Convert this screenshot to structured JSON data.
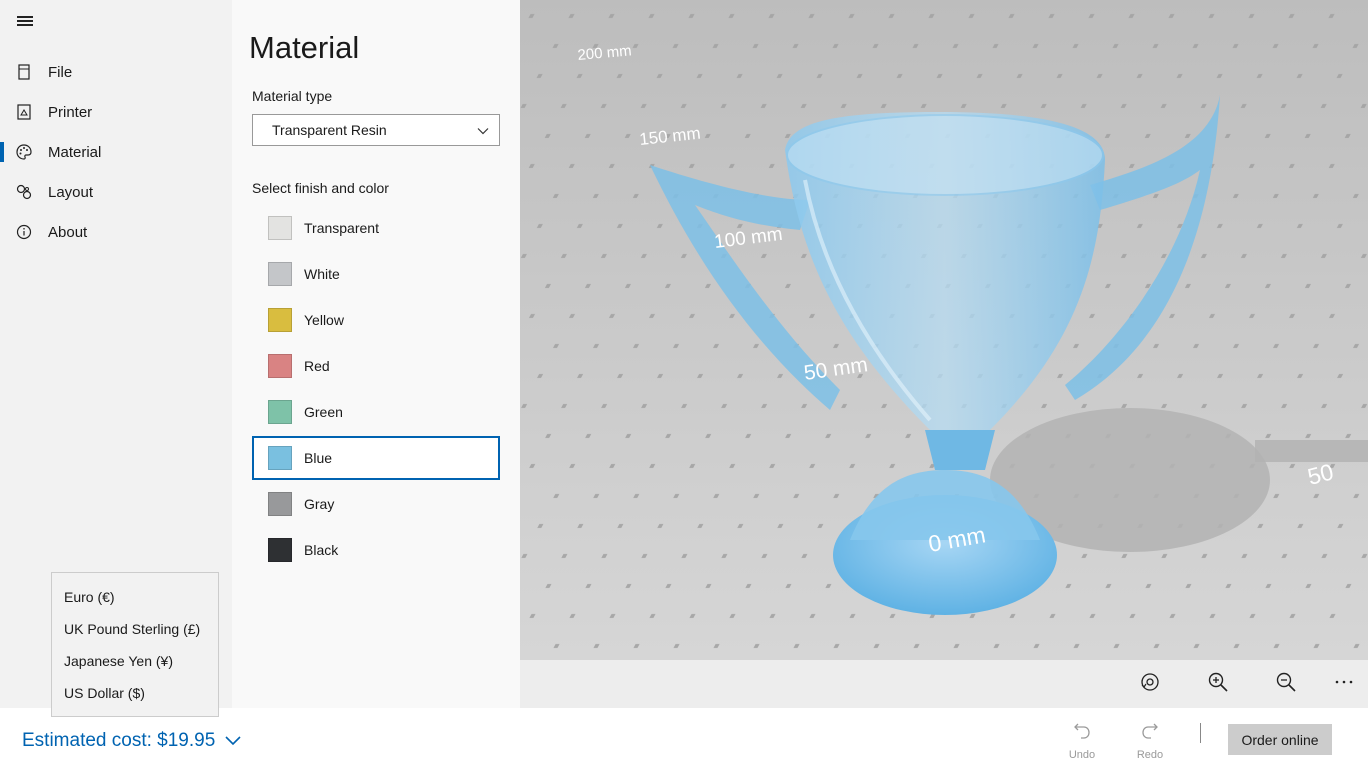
{
  "nav": {
    "items": [
      {
        "label": "File",
        "icon": "file-icon"
      },
      {
        "label": "Printer",
        "icon": "printer-icon"
      },
      {
        "label": "Material",
        "icon": "palette-icon",
        "active": true
      },
      {
        "label": "Layout",
        "icon": "layout-icon"
      },
      {
        "label": "About",
        "icon": "info-icon"
      }
    ]
  },
  "material": {
    "title": "Material",
    "type_label": "Material type",
    "type_value": "Transparent Resin",
    "finish_label": "Select finish and color",
    "colors": [
      {
        "label": "Transparent",
        "color": "#e3e3e1"
      },
      {
        "label": "White",
        "color": "#c4c6c9"
      },
      {
        "label": "Yellow",
        "color": "#d9bd3f"
      },
      {
        "label": "Red",
        "color": "#d98383"
      },
      {
        "label": "Green",
        "color": "#7ec2a8"
      },
      {
        "label": "Blue",
        "color": "#7ac0e0",
        "selected": true
      },
      {
        "label": "Gray",
        "color": "#98999b"
      },
      {
        "label": "Black",
        "color": "#2e3033"
      }
    ]
  },
  "currency": {
    "options": [
      "Euro (€)",
      "UK Pound Sterling (£)",
      "Japanese Yen (¥)",
      "US Dollar ($)"
    ]
  },
  "viewport": {
    "axis_labels": [
      "200 mm",
      "150 mm",
      "100 mm",
      "50 mm",
      "0 mm",
      "50"
    ],
    "model_color": "#6ab8e6"
  },
  "bottom": {
    "estimated_cost": "Estimated cost: $19.95",
    "undo": "Undo",
    "redo": "Redo",
    "order": "Order online"
  },
  "colors": {
    "accent": "#0063b1"
  }
}
